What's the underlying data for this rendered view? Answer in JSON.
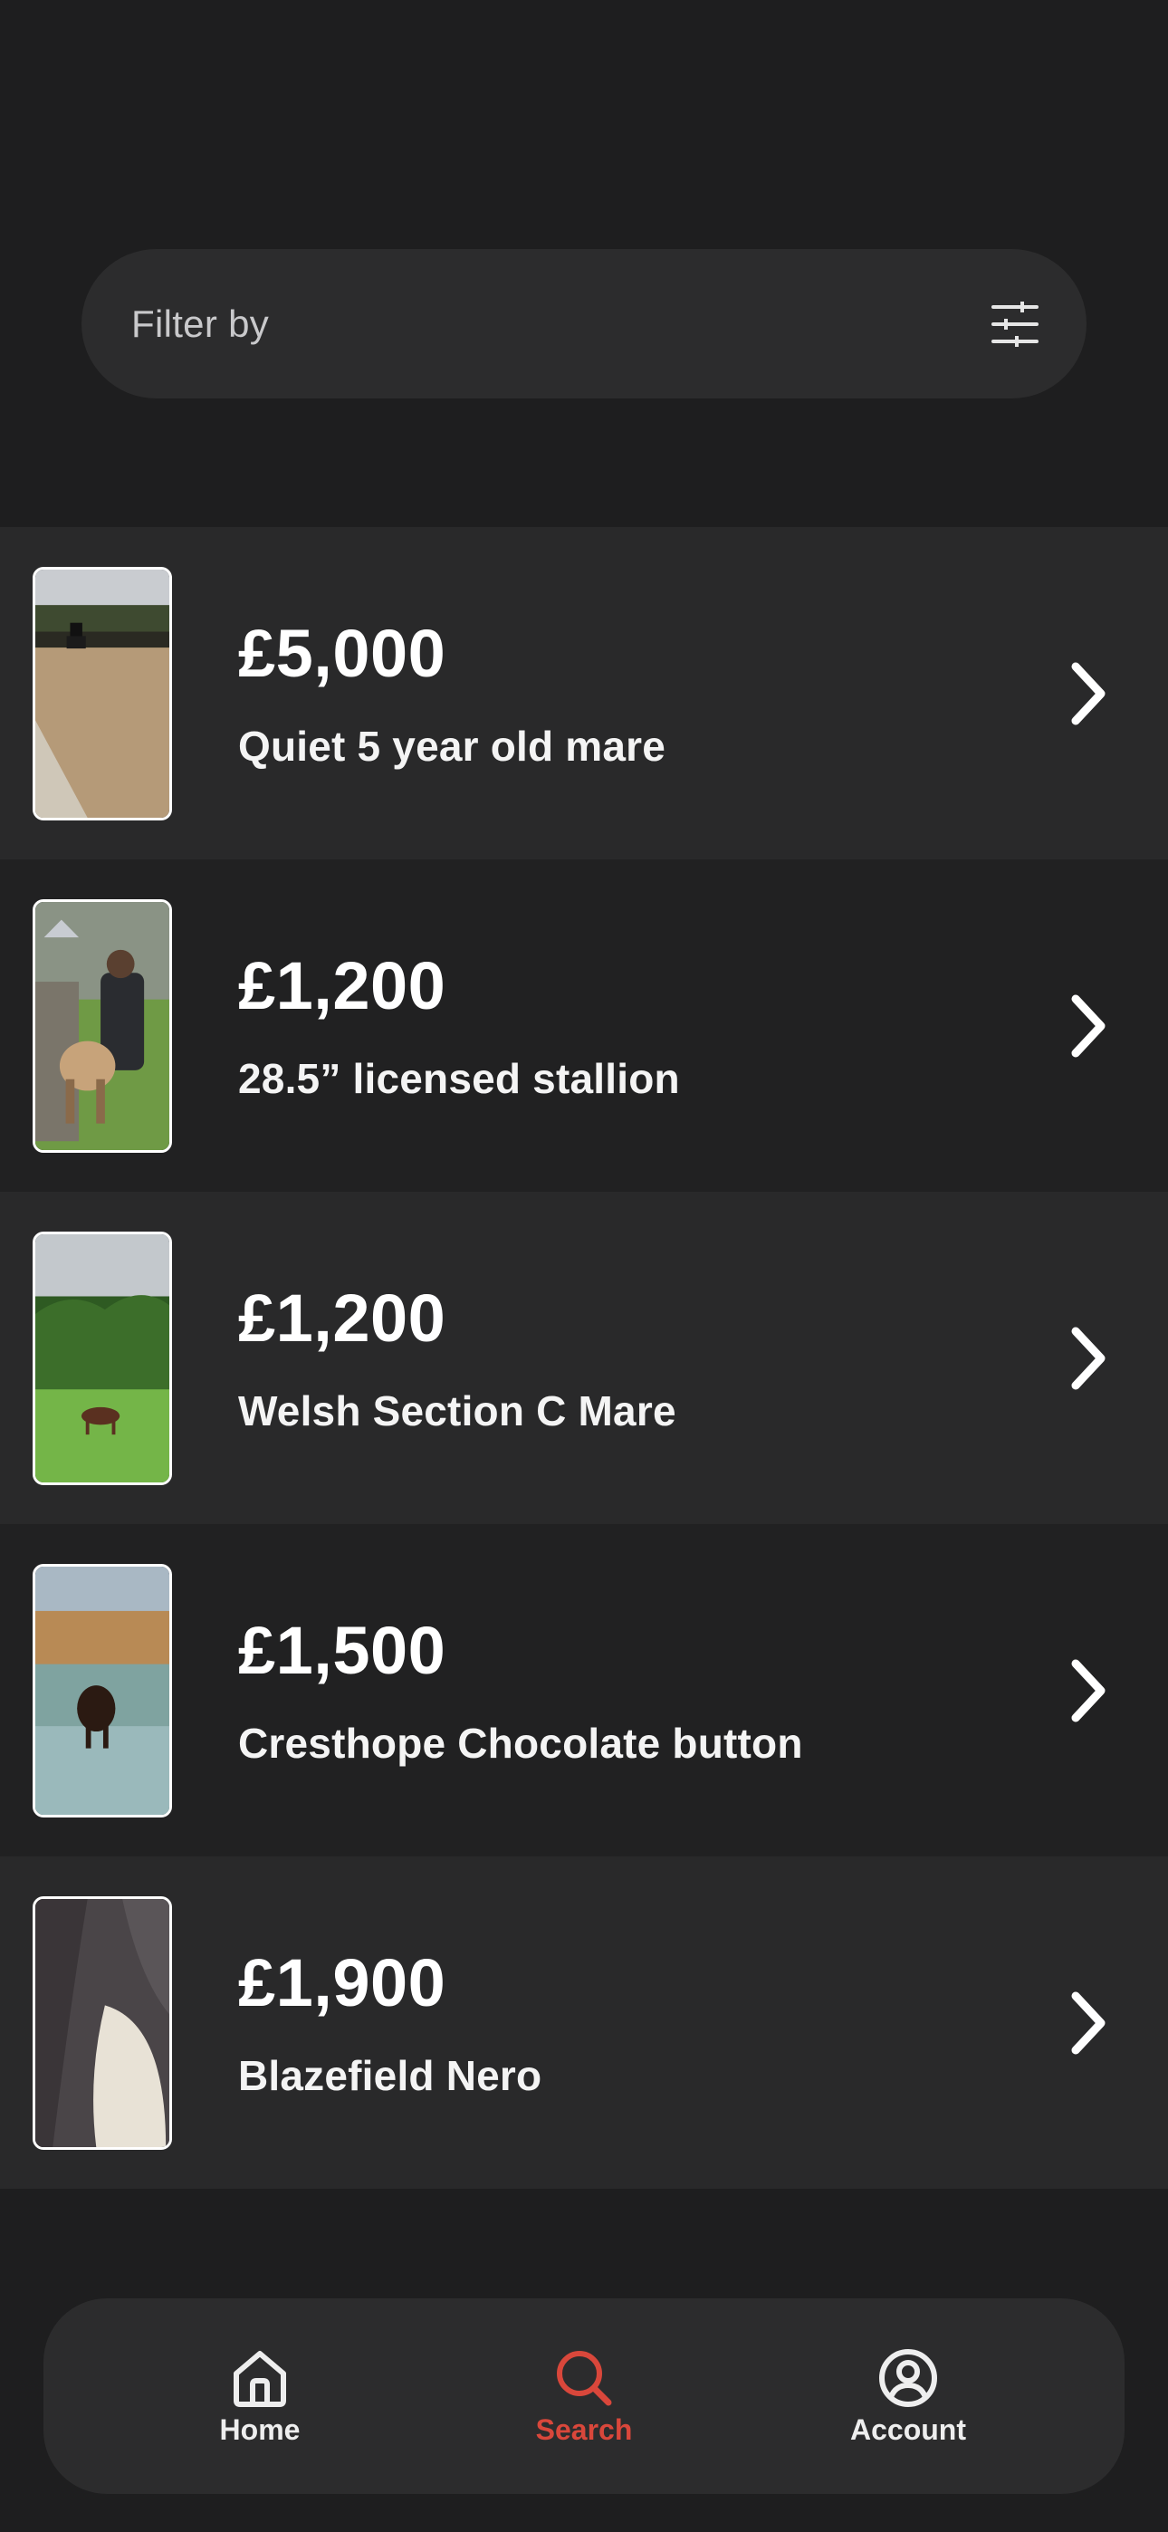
{
  "filter": {
    "placeholder": "Filter by",
    "icon": "sliders-icon"
  },
  "listings": [
    {
      "price": "£5,000",
      "title": "Quiet 5 year old mare",
      "thumbnail": "horse-arena-photo"
    },
    {
      "price": "£1,200",
      "title": "28.5” licensed stallion",
      "thumbnail": "pony-with-handler-photo"
    },
    {
      "price": "£1,200",
      "title": "Welsh Section C Mare",
      "thumbnail": "horse-in-field-photo"
    },
    {
      "price": "£1,500",
      "title": "Cresthope Chocolate button",
      "thumbnail": "pony-frosty-field-photo"
    },
    {
      "price": "£1,900",
      "title": "Blazefield Nero",
      "thumbnail": "horse-closeup-photo"
    }
  ],
  "nav": {
    "items": [
      {
        "label": "Home",
        "icon": "home-icon",
        "active": false
      },
      {
        "label": "Search",
        "icon": "search-icon",
        "active": true
      },
      {
        "label": "Account",
        "icon": "account-icon",
        "active": false
      }
    ]
  },
  "colors": {
    "background": "#1e1e1f",
    "accent": "#d9473b",
    "row_alt": "#29292a",
    "row_base": "#212122"
  }
}
